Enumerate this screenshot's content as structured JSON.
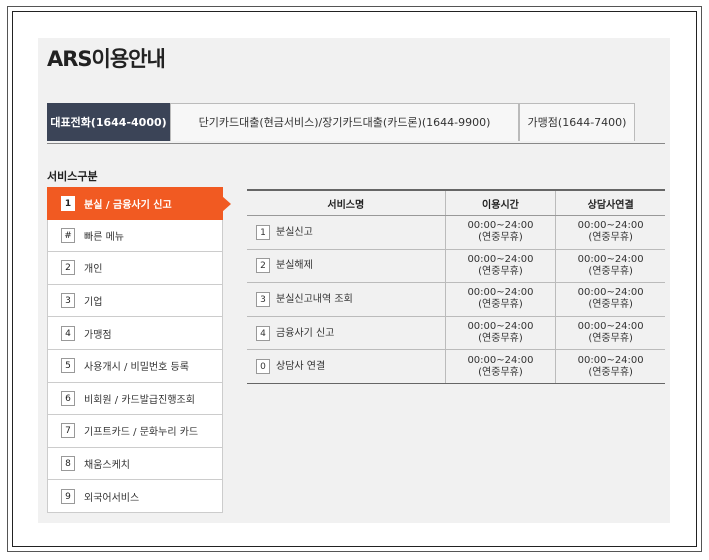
{
  "page": {
    "title": "ARS이용안내"
  },
  "tabs": [
    {
      "label": "대표전화(1644-4000)",
      "active": true
    },
    {
      "label": "단기카드대출(현금서비스)/장기카드대출(카드론)(1644-9900)",
      "active": false
    },
    {
      "label": "가맹점(1644-7400)",
      "active": false
    }
  ],
  "service_section_label": "서비스구분",
  "menu": [
    {
      "num": "1",
      "label": "분실 / 금융사기 신고",
      "active": true
    },
    {
      "num": "#",
      "label": "빠른 메뉴"
    },
    {
      "num": "2",
      "label": "개인"
    },
    {
      "num": "3",
      "label": "기업"
    },
    {
      "num": "4",
      "label": "가맹점"
    },
    {
      "num": "5",
      "label": "사용개시 / 비밀번호 등록"
    },
    {
      "num": "6",
      "label": "비회원 / 카드발급진행조회"
    },
    {
      "num": "7",
      "label": "기프트카드 / 문화누리 카드"
    },
    {
      "num": "8",
      "label": "채움스케치"
    },
    {
      "num": "9",
      "label": "외국어서비스"
    }
  ],
  "table": {
    "headers": [
      "서비스명",
      "이용시간",
      "상담사연결"
    ],
    "rows": [
      {
        "num": "1",
        "name": "분실신고",
        "time": "00:00~24:00",
        "time_note": "(연중무휴)",
        "agent": "00:00~24:00",
        "agent_note": "(연중무휴)"
      },
      {
        "num": "2",
        "name": "분실해제",
        "time": "00:00~24:00",
        "time_note": "(연중무휴)",
        "agent": "00:00~24:00",
        "agent_note": "(연중무휴)"
      },
      {
        "num": "3",
        "name": "분실신고내역 조회",
        "time": "00:00~24:00",
        "time_note": "(연중무휴)",
        "agent": "00:00~24:00",
        "agent_note": "(연중무휴)"
      },
      {
        "num": "4",
        "name": "금융사기 신고",
        "time": "00:00~24:00",
        "time_note": "(연중무휴)",
        "agent": "00:00~24:00",
        "agent_note": "(연중무휴)"
      },
      {
        "num": "0",
        "name": "상담사 연결",
        "time": "00:00~24:00",
        "time_note": "(연중무휴)",
        "agent": "00:00~24:00",
        "agent_note": "(연중무휴)"
      }
    ]
  },
  "colors": {
    "accent": "#f15a22",
    "active_tab": "#3b4457",
    "panel_bg": "#f1f1f1"
  }
}
